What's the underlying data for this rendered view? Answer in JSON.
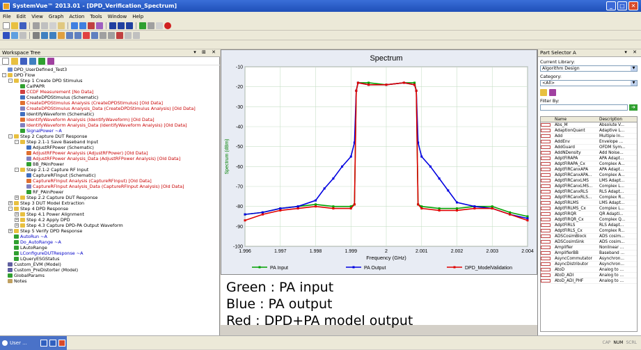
{
  "window": {
    "title": "SystemVue™ 2013.01 - [DPD_Verification_Spectrum]",
    "min_label": "_",
    "max_label": "□",
    "close_label": "✕"
  },
  "menu": [
    "File",
    "Edit",
    "View",
    "Graph",
    "Action",
    "Tools",
    "Window",
    "Help"
  ],
  "workspace": {
    "title": "Workspace Tree",
    "tree": [
      {
        "label": "DPD_UserDefined_Test3",
        "level": 0,
        "color": "normal",
        "icon": "doc-icon",
        "toggle": ""
      },
      {
        "label": "DPD Flow",
        "level": 0,
        "color": "normal",
        "icon": "folder-icon",
        "toggle": "-"
      },
      {
        "label": "Step 1 Create DPD Stimulus",
        "level": 1,
        "color": "normal",
        "icon": "folder-icon",
        "toggle": "-"
      },
      {
        "label": "CalPAPR",
        "level": 2,
        "color": "normal",
        "icon": "equation-icon",
        "toggle": ""
      },
      {
        "label": "CCDF Measurement [No Data]",
        "level": 2,
        "color": "red",
        "icon": "graph-icon",
        "toggle": ""
      },
      {
        "label": "CreateDPDStimulus (Schematic)",
        "level": 2,
        "color": "normal",
        "icon": "schematic-icon",
        "toggle": ""
      },
      {
        "label": "CreateDPDStimulus Analysis (CreateDPDStimulus) [Old Data]",
        "level": 2,
        "color": "red",
        "icon": "analysis-icon",
        "toggle": ""
      },
      {
        "label": "CreateDPDStimulus Analysis_Data (CreateDPDStimulus Analysis) [Old Data]",
        "level": 2,
        "color": "red",
        "icon": "data-icon",
        "toggle": ""
      },
      {
        "label": "IdentifyWaveform (Schematic)",
        "level": 2,
        "color": "normal",
        "icon": "schematic-icon",
        "toggle": ""
      },
      {
        "label": "IdentifyWaveform Analysis (IdentifyWaveform) [Old Data]",
        "level": 2,
        "color": "red",
        "icon": "analysis-icon",
        "toggle": ""
      },
      {
        "label": "IdentifyWaveform Analysis_Data (IdentifyWaveform Analysis) [Old Data]",
        "level": 2,
        "color": "red",
        "icon": "data-icon",
        "toggle": ""
      },
      {
        "label": "SignalPower ~A",
        "level": 2,
        "color": "blue",
        "icon": "equation-icon",
        "toggle": ""
      },
      {
        "label": "Step 2 Capture DUT Response",
        "level": 1,
        "color": "normal",
        "icon": "folder-icon",
        "toggle": "-"
      },
      {
        "label": "Step 2.1-1 Save Baseband Input",
        "level": 2,
        "color": "normal",
        "icon": "folder-icon",
        "toggle": "-"
      },
      {
        "label": "AdjustRFPower (Schematic)",
        "level": 3,
        "color": "normal",
        "icon": "schematic-icon",
        "toggle": ""
      },
      {
        "label": "AdjustRFPower Analysis (AdjustRFPower) [Old Data]",
        "level": 3,
        "color": "red",
        "icon": "analysis-icon",
        "toggle": ""
      },
      {
        "label": "AdjustRFPower Analysis_Data (AdjustRFPower Analysis) [Old Data]",
        "level": 3,
        "color": "red",
        "icon": "data-icon",
        "toggle": ""
      },
      {
        "label": "BB_PAInPower",
        "level": 3,
        "color": "normal",
        "icon": "equation-icon",
        "toggle": ""
      },
      {
        "label": "Step 2.1-2 Capture RF Input",
        "level": 2,
        "color": "normal",
        "icon": "folder-icon",
        "toggle": "-"
      },
      {
        "label": "CaptureRFInput (Schematic)",
        "level": 3,
        "color": "normal",
        "icon": "schematic-icon",
        "toggle": ""
      },
      {
        "label": "CaptureRFInput Analysis (CaptureRFInput) [Old Data]",
        "level": 3,
        "color": "red",
        "icon": "analysis-icon",
        "toggle": ""
      },
      {
        "label": "CaptureRFInput Analysis_Data (CaptureRFInput Analysis) [Old Data]",
        "level": 3,
        "color": "red",
        "icon": "data-icon",
        "toggle": ""
      },
      {
        "label": "RF_PAInPower",
        "level": 3,
        "color": "normal",
        "icon": "equation-icon",
        "toggle": ""
      },
      {
        "label": "Step 2.2 Capture DUT Response",
        "level": 2,
        "color": "normal",
        "icon": "folder-icon",
        "toggle": "+"
      },
      {
        "label": "Step 3 DUT Model Extraction",
        "level": 1,
        "color": "normal",
        "icon": "folder-icon",
        "toggle": "+"
      },
      {
        "label": "Step 4 DPD Response",
        "level": 1,
        "color": "normal",
        "icon": "folder-icon",
        "toggle": "-"
      },
      {
        "label": "Step 4.1 Power Alignment",
        "level": 2,
        "color": "normal",
        "icon": "folder-icon",
        "toggle": "+"
      },
      {
        "label": "Step 4.2 Apply DPD",
        "level": 2,
        "color": "normal",
        "icon": "folder-icon",
        "toggle": "+"
      },
      {
        "label": "Step 4.3 Capture DPD-PA Output Waveform",
        "level": 2,
        "color": "normal",
        "icon": "folder-icon",
        "toggle": "+"
      },
      {
        "label": "Step 5 Verify DPD Response",
        "level": 1,
        "color": "normal",
        "icon": "folder-icon",
        "toggle": "+"
      },
      {
        "label": "AutoRun ~A",
        "level": 1,
        "color": "blue",
        "icon": "equation-icon",
        "toggle": ""
      },
      {
        "label": "Do_AutoRange ~A",
        "level": 1,
        "color": "blue",
        "icon": "equation-icon",
        "toggle": ""
      },
      {
        "label": "LAutoRange",
        "level": 1,
        "color": "normal",
        "icon": "equation-icon",
        "toggle": ""
      },
      {
        "label": "LConfigureDUTResponse ~A",
        "level": 1,
        "color": "blue",
        "icon": "equation-icon",
        "toggle": ""
      },
      {
        "label": "LQueryESGStatus",
        "level": 1,
        "color": "normal",
        "icon": "equation-icon",
        "toggle": ""
      },
      {
        "label": "Custom_EVM (Model)",
        "level": 0,
        "color": "normal",
        "icon": "model-icon",
        "toggle": ""
      },
      {
        "label": "Custom_PreDistorter (Model)",
        "level": 0,
        "color": "normal",
        "icon": "model-icon",
        "toggle": ""
      },
      {
        "label": "GlobalParams",
        "level": 0,
        "color": "normal",
        "icon": "equation-icon",
        "toggle": ""
      },
      {
        "label": "Notes",
        "level": 0,
        "color": "normal",
        "icon": "note-icon",
        "toggle": ""
      }
    ]
  },
  "parts": {
    "title": "Part Selector A",
    "current_library_label": "Current Library:",
    "current_library": "Algorithm Design",
    "category_label": "Category:",
    "category": "<All>",
    "filter_label": "Filter By:",
    "filter_value": "",
    "col_name": "Name",
    "col_desc": "Description",
    "rows": [
      [
        "Abs_M",
        "Absolute V..."
      ],
      [
        "AdaptionQuant",
        "Adaptive L..."
      ],
      [
        "Add",
        "Multiple In..."
      ],
      [
        "AddEnv",
        "Envelope ..."
      ],
      [
        "AddGuard",
        "OFDM Sym..."
      ],
      [
        "AddNDensity",
        "Add Noise..."
      ],
      [
        "AdptFIRAPA",
        "APA Adapt..."
      ],
      [
        "AdptFIRAPA_Cx",
        "Complex A..."
      ],
      [
        "AdptFIRCanxAPA",
        "APA Adapt..."
      ],
      [
        "AdptFIRCanxAPA...",
        "Complex A..."
      ],
      [
        "AdptFIRCanxLMS",
        "LMS Adapt..."
      ],
      [
        "AdptFIRCanxLMS...",
        "Complex L..."
      ],
      [
        "AdptFIRCanxRLS",
        "RLS Adapt..."
      ],
      [
        "AdptFIRCanxRLS...",
        "Complex R..."
      ],
      [
        "AdptFIRLMS",
        "LMS Adapt..."
      ],
      [
        "AdptFIRLMS_Cx",
        "Complex L..."
      ],
      [
        "AdptFIRQR",
        "QR Adapti..."
      ],
      [
        "AdptFIRQR_Cx",
        "Complex Q..."
      ],
      [
        "AdptFIRLS",
        "RLS Adapt..."
      ],
      [
        "AdptFIRLS_Cx",
        "Complex R..."
      ],
      [
        "ADSCosimBlock",
        "ADS cosim..."
      ],
      [
        "ADSCosimSink",
        "ADS cosim..."
      ],
      [
        "Amplifier",
        "Nonlinear ..."
      ],
      [
        "AmplifierBB",
        "Baseband ..."
      ],
      [
        "AsyncCommutator",
        "Asynchron..."
      ],
      [
        "AsyncDistributor",
        "Asynchron..."
      ],
      [
        "AtoD",
        "Analog to ..."
      ],
      [
        "AtoD_ADI",
        "Analog to ..."
      ],
      [
        "AtoD_ADI_PHF",
        "Analog to ..."
      ]
    ]
  },
  "legend_text": [
    "Green : PA input",
    "Blue :  PA output",
    "Red : DPD+PA model output"
  ],
  "status": {
    "tab_label": "User ...",
    "cap": "CAP",
    "num": "NUM",
    "scrl": "SCRL"
  },
  "chart_data": {
    "type": "line",
    "title": "Spectrum",
    "xlabel": "Frequency (GHz)",
    "ylabel": "Spectrum (dBm)",
    "xlim": [
      1.996,
      2.004
    ],
    "ylim": [
      -100,
      -10
    ],
    "x_ticks": [
      "1.996",
      "1.997",
      "1.998",
      "1.999",
      "2",
      "2.001",
      "2.002",
      "2.003",
      "2.004"
    ],
    "y_ticks": [
      "-10",
      "-20",
      "-30",
      "-40",
      "-50",
      "-60",
      "-70",
      "-80",
      "-90",
      "-100"
    ],
    "grid": true,
    "legend_position": "bottom",
    "series": [
      {
        "name": "PA Input",
        "color": "#00a000",
        "x": [
          1.996,
          1.9965,
          1.997,
          1.9975,
          1.998,
          1.9985,
          1.999,
          1.9991,
          1.99915,
          1.9992,
          1.9995,
          2.0,
          2.0005,
          2.0008,
          2.00085,
          2.0009,
          2.001,
          2.0015,
          2.002,
          2.0025,
          2.003,
          2.0035,
          2.004
        ],
        "y": [
          -84,
          -83,
          -81,
          -80,
          -79,
          -80,
          -80,
          -79,
          -22,
          -18,
          -18,
          -19,
          -18,
          -18,
          -22,
          -79,
          -80,
          -81,
          -81,
          -80,
          -80,
          -83,
          -85
        ]
      },
      {
        "name": "PA Output",
        "color": "#0000e0",
        "x": [
          1.996,
          1.9965,
          1.997,
          1.9975,
          1.998,
          1.99825,
          1.9985,
          1.99875,
          1.999,
          1.9991,
          1.99915,
          1.9992,
          1.9995,
          2.0,
          2.0005,
          2.0008,
          2.00085,
          2.0009,
          2.001,
          2.00125,
          2.0015,
          2.00175,
          2.002,
          2.0025,
          2.003,
          2.0035,
          2.004
        ],
        "y": [
          -84,
          -83,
          -81,
          -80,
          -77,
          -71,
          -66,
          -60,
          -55,
          -48,
          -22,
          -18,
          -19,
          -19,
          -18,
          -19,
          -22,
          -48,
          -55,
          -60,
          -66,
          -72,
          -78,
          -80,
          -81,
          -84,
          -86
        ]
      },
      {
        "name": "DPD_ModelValidation",
        "color": "#e00000",
        "x": [
          1.996,
          1.9965,
          1.997,
          1.9975,
          1.998,
          1.9985,
          1.999,
          1.9991,
          1.99915,
          1.9992,
          1.9995,
          2.0,
          2.0005,
          2.0008,
          2.00085,
          2.0009,
          2.001,
          2.0015,
          2.002,
          2.0025,
          2.003,
          2.0035,
          2.004
        ],
        "y": [
          -87,
          -84,
          -82,
          -81,
          -80,
          -81,
          -81,
          -79,
          -22,
          -18,
          -19,
          -19,
          -18,
          -19,
          -22,
          -79,
          -81,
          -82,
          -82,
          -81,
          -81,
          -84,
          -87
        ]
      }
    ]
  }
}
